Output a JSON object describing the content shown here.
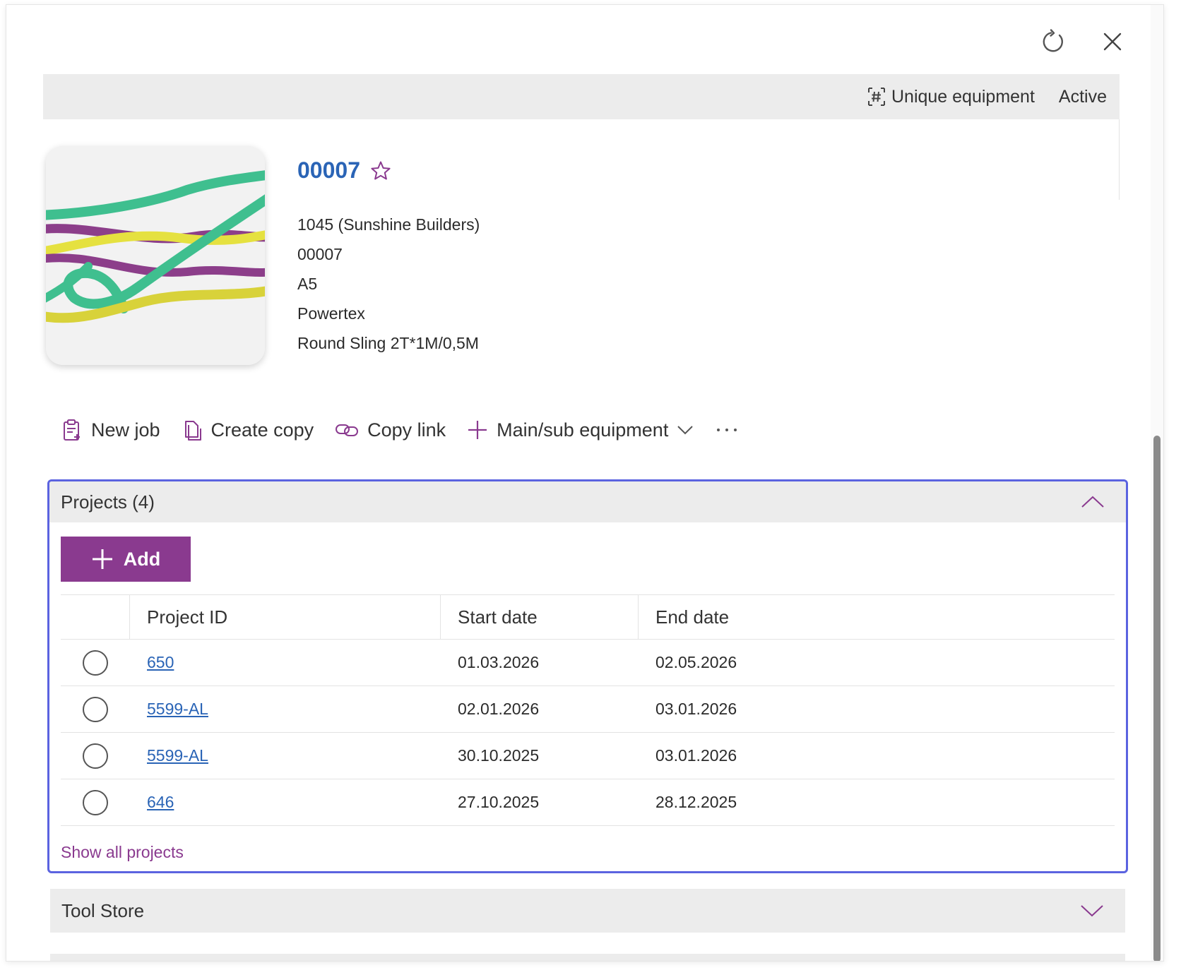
{
  "header": {
    "record_type": "Unique equipment",
    "status": "Active"
  },
  "equipment": {
    "title": "00007",
    "details": [
      "1045 (Sunshine Builders)",
      "00007",
      "A5",
      "Powertex",
      "Round Sling 2T*1M/0,5M"
    ]
  },
  "commands": {
    "new_job": "New job",
    "create_copy": "Create copy",
    "copy_link": "Copy link",
    "main_sub": "Main/sub equipment"
  },
  "projects": {
    "title": "Projects (4)",
    "add_label": "Add",
    "columns": {
      "project_id": "Project ID",
      "start_date": "Start date",
      "end_date": "End date"
    },
    "rows": [
      {
        "project_id": "650",
        "start_date": "01.03.2026",
        "end_date": "02.05.2026"
      },
      {
        "project_id": "5599-AL",
        "start_date": "02.01.2026",
        "end_date": "03.01.2026"
      },
      {
        "project_id": "5599-AL",
        "start_date": "30.10.2025",
        "end_date": "03.01.2026"
      },
      {
        "project_id": "646",
        "start_date": "27.10.2025",
        "end_date": "28.12.2025"
      }
    ],
    "show_all": "Show all projects"
  },
  "tool_store": {
    "title": "Tool Store"
  },
  "icons": {
    "refresh": "refresh-icon",
    "close": "close-icon",
    "unique": "hash-frame-icon",
    "favorite": "star-icon",
    "new_job": "clipboard-add-icon",
    "create_copy": "copy-icon",
    "copy_link": "link-icon",
    "main_sub": "plus-icon",
    "more": "more-horizontal-icon",
    "collapse": "chevron-up-icon",
    "expand": "chevron-down-icon"
  },
  "colors": {
    "accent": "#8a3a8f",
    "link": "#2a64b6",
    "focus_border": "#5b63e0",
    "section_bg": "#ececec"
  }
}
